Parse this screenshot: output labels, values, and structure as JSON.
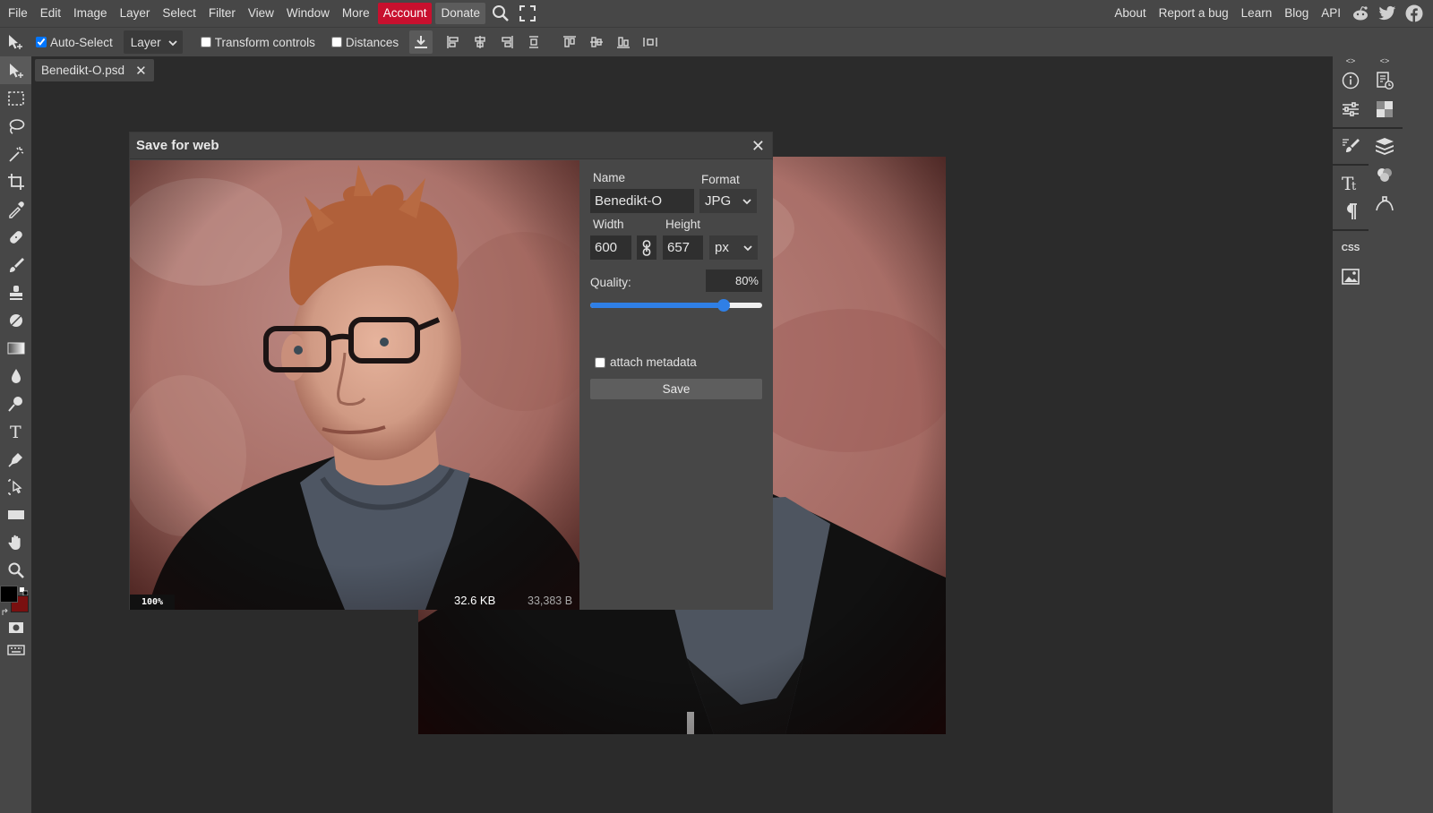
{
  "menu": {
    "items": [
      "File",
      "Edit",
      "Image",
      "Layer",
      "Select",
      "Filter",
      "View",
      "Window",
      "More"
    ],
    "account": "Account",
    "donate": "Donate",
    "right_links": [
      "About",
      "Report a bug",
      "Learn",
      "Blog",
      "API"
    ]
  },
  "options": {
    "auto_select": "Auto-Select",
    "auto_select_checked": true,
    "layer_select": "Layer",
    "transform_controls": "Transform controls",
    "distances": "Distances"
  },
  "document": {
    "tab_name": "Benedikt-O.psd",
    "close_glyph": "✕"
  },
  "dialog": {
    "title": "Save for web",
    "close_glyph": "✕",
    "name_label": "Name",
    "name_value": "Benedikt-O",
    "format_label": "Format",
    "format_value": "JPG",
    "width_label": "Width",
    "width_value": "600",
    "height_label": "Height",
    "height_value": "657",
    "unit_value": "px",
    "quality_label": "Quality:",
    "quality_value": "80%",
    "quality_fraction": 0.8,
    "attach_metadata": "attach metadata",
    "save_label": "Save",
    "zoom": "100%",
    "file_size_kb": "32.6 KB",
    "file_size_bytes": "33,383 B"
  },
  "right_panel": {
    "css_label": "CSS"
  },
  "colors": {
    "accent": "#2f7fe6",
    "account_red": "#c8102e",
    "foreground_color": "#000000",
    "background_color": "#7a1010"
  }
}
